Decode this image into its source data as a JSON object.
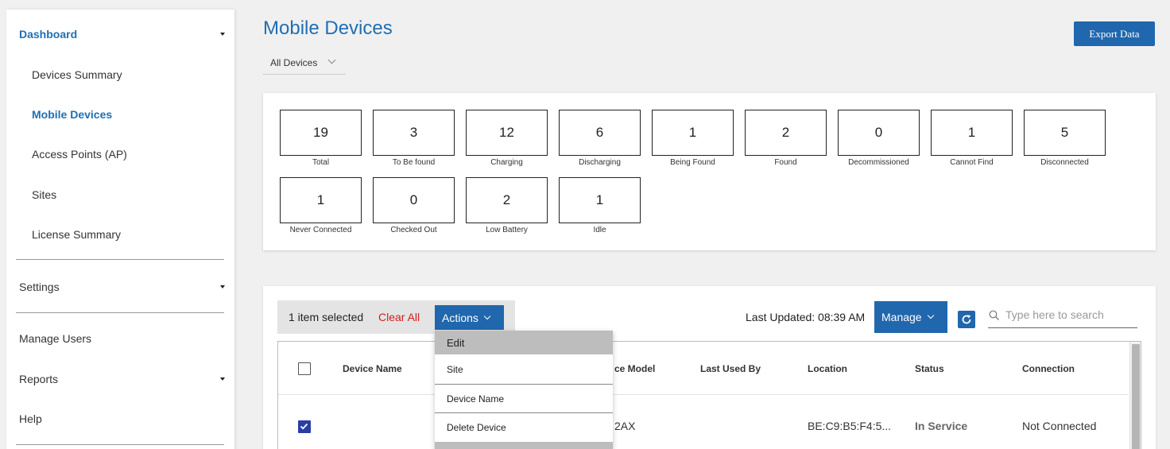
{
  "sidebar": {
    "dashboard": "Dashboard",
    "sub_items": [
      "Devices Summary",
      "Mobile Devices",
      "Access Points (AP)",
      "Sites",
      "License Summary"
    ],
    "settings": "Settings",
    "manage_users": "Manage Users",
    "reports": "Reports",
    "help": "Help"
  },
  "header": {
    "title": "Mobile Devices",
    "export_label": "Export Data",
    "filter_value": "All Devices"
  },
  "stats": [
    {
      "value": "19",
      "label": "Total"
    },
    {
      "value": "3",
      "label": "To Be found"
    },
    {
      "value": "12",
      "label": "Charging"
    },
    {
      "value": "6",
      "label": "Discharging"
    },
    {
      "value": "1",
      "label": "Being Found"
    },
    {
      "value": "2",
      "label": "Found"
    },
    {
      "value": "0",
      "label": "Decommissioned"
    },
    {
      "value": "1",
      "label": "Cannot Find"
    },
    {
      "value": "5",
      "label": "Disconnected"
    },
    {
      "value": "1",
      "label": "Never Connected"
    },
    {
      "value": "0",
      "label": "Checked Out"
    },
    {
      "value": "2",
      "label": "Low Battery"
    },
    {
      "value": "1",
      "label": "Idle"
    }
  ],
  "toolbar": {
    "selected_text": "1 item selected",
    "clear_all": "Clear All",
    "actions_label": "Actions",
    "last_updated": "Last Updated: 08:39 AM",
    "manage_label": "Manage",
    "search_placeholder": "Type here to search"
  },
  "actions_menu": [
    "Edit",
    "Site",
    "Device Name",
    "Delete Device"
  ],
  "table": {
    "columns": [
      "Device Name",
      "ce Model",
      "Last Used By",
      "Location",
      "Status",
      "Connection"
    ],
    "rows": [
      {
        "model": "2AX",
        "location": "BE:C9:B5:F4:5...",
        "status": "In Service",
        "connection": "Not Connected"
      }
    ]
  },
  "colors": {
    "accent": "#2067ad",
    "title": "#1f6fb2",
    "danger": "#d32020",
    "checkbox": "#283ea6"
  }
}
